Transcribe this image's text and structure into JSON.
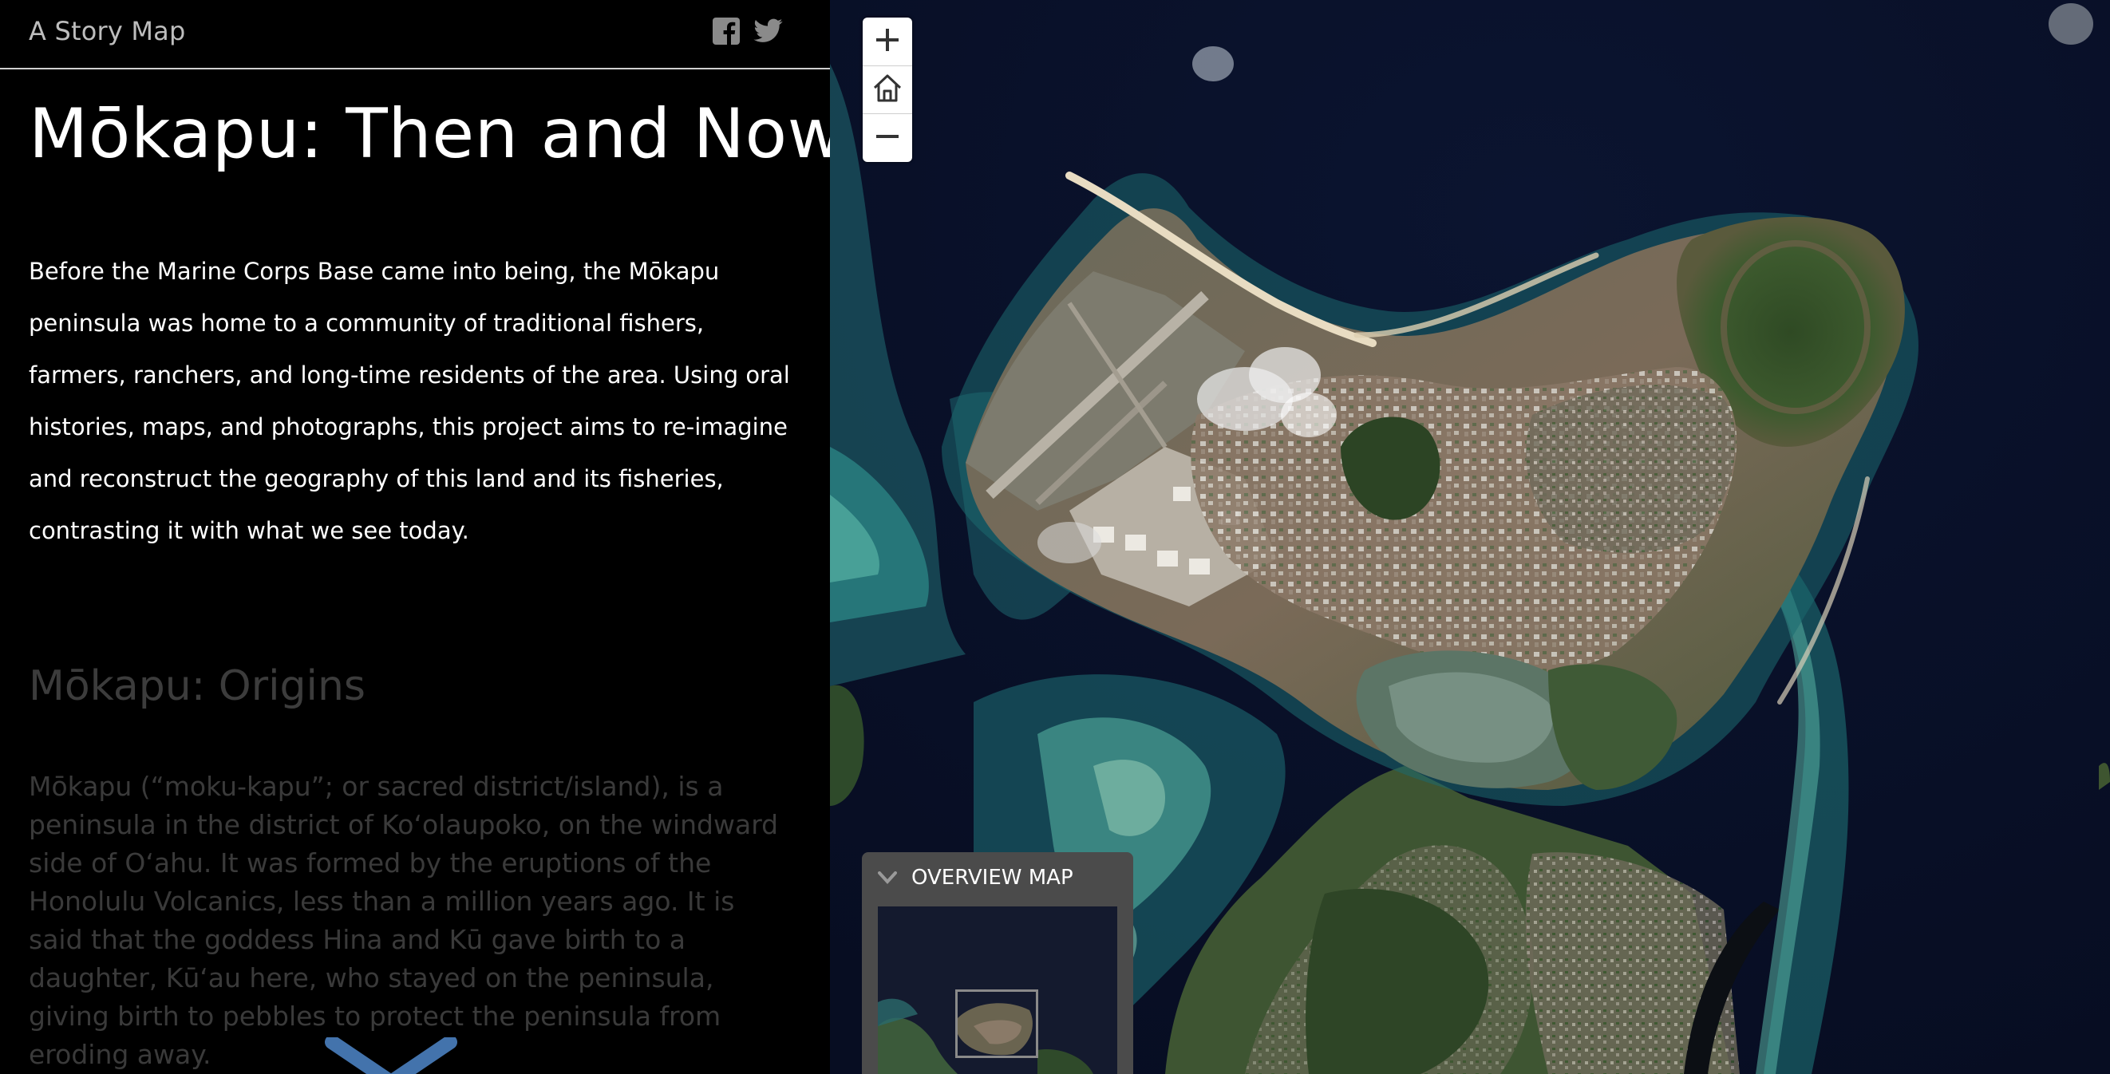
{
  "header": {
    "app_title": "A Story Map",
    "share_icons": [
      "facebook-icon",
      "twitter-icon"
    ]
  },
  "story": {
    "title": "Mōkapu: Then and Now",
    "intro": "Before the Marine Corps Base came into being, the Mōkapu peninsula was home to a community of traditional fishers, farmers, ranchers, and long-time residents of the area. Using oral histories, maps, and photographs, this project aims to re-imagine and reconstruct the geography of this land and its fisheries, contrasting it with what we see today.",
    "next_section": {
      "title": "Mōkapu: Origins",
      "body": "Mōkapu (“moku-kapu”; or sacred district/island), is a peninsula in the district of Ko‘olaupoko, on the windward side of O‘ahu. It was formed by the eruptions of the Honolulu Volcanics, less than a million years ago. It is said that the goddess Hina and Kū gave birth to a daughter, Kū‘au here, who stayed on the peninsula, giving birth to pebbles to protect the peninsula from eroding away."
    },
    "scroll_icon": "chevron-down-icon"
  },
  "map": {
    "basemap": "satellite imagery",
    "controls": {
      "zoom_in_icon": "plus-icon",
      "home_icon": "home-icon",
      "zoom_out_icon": "minus-icon"
    },
    "overview": {
      "label": "OVERVIEW MAP",
      "toggle_icon": "chevron-down-icon"
    }
  },
  "colors": {
    "panel_bg": "#000000",
    "title_text": "#ffffff",
    "faded_text": "#3c3c3c",
    "scroll_arrow": "#4a7fbf",
    "overview_bg": "#4b4b4b",
    "ocean_deep": "#07102a",
    "reef": "#2e8c8a"
  }
}
